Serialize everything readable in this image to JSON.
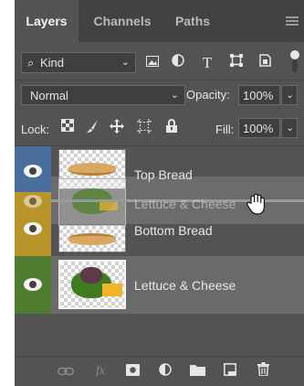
{
  "tabs": [
    {
      "label": "Layers",
      "active": true
    },
    {
      "label": "Channels",
      "active": false
    },
    {
      "label": "Paths",
      "active": false
    }
  ],
  "filter": {
    "kind_label": "Kind",
    "icons": [
      "image-filter-icon",
      "adjustment-filter-icon",
      "type-filter-icon",
      "shape-filter-icon",
      "smart-object-filter-icon"
    ],
    "type_glyph": "T"
  },
  "blend_mode": "Normal",
  "opacity_label": "Opacity:",
  "opacity_value": "100%",
  "lock_label": "Lock:",
  "fill_label": "Fill:",
  "fill_value": "100%",
  "layers": [
    {
      "name": "Top Bread",
      "color": "#4a6f9c",
      "visible": true
    },
    {
      "name": "Bottom Bread",
      "color": "#b8942a",
      "visible": true
    },
    {
      "name": "Lettuce & Cheese",
      "color": "#4e7d2f",
      "visible": true,
      "selected": true
    }
  ],
  "dragging_layer": {
    "name": "Lettuce & Cheese"
  },
  "colors": {
    "panel": "#535353",
    "tab_bar": "#424242",
    "selected_row": "#6a6a6a",
    "blue_label": "#4a6f9c",
    "yellow_label": "#b8942a",
    "green_label": "#4e7d2f"
  }
}
